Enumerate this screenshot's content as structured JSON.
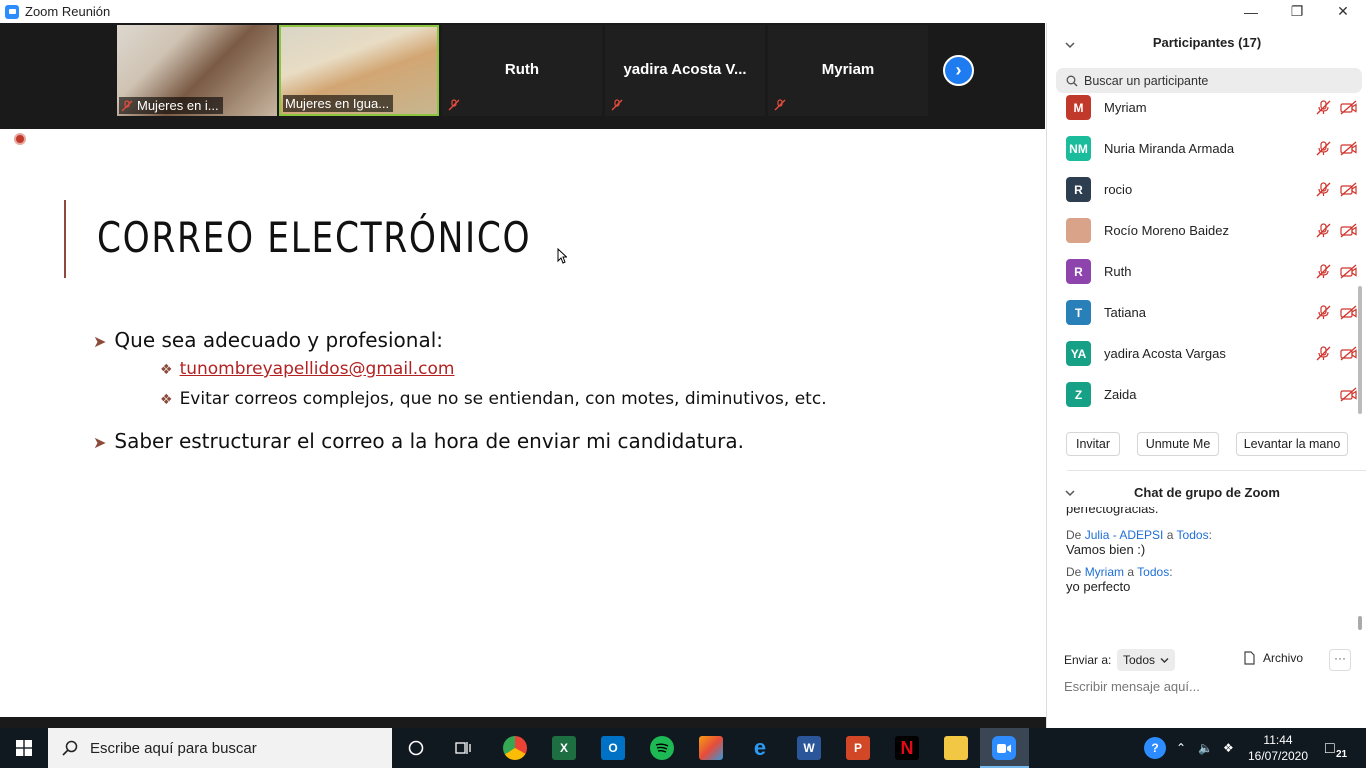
{
  "window": {
    "title": "Zoom Reunión"
  },
  "video_strip": {
    "tiles": [
      {
        "label": "Mujeres en i..."
      },
      {
        "label": "Mujeres en Igua..."
      },
      {
        "name": "Ruth"
      },
      {
        "name": "yadira Acosta V..."
      },
      {
        "name": "Myriam"
      }
    ],
    "next_button": "›"
  },
  "slide": {
    "title": "CORREO ELECTRÓNICO",
    "bullet1": "Que sea adecuado y profesional:",
    "sub1": "tunombreyapellidos@gmail.com",
    "sub2": "Evitar correos complejos, que no se entiendan, con motes, diminutivos, etc.",
    "bullet2": "Saber estructurar el correo a la hora de enviar mi candidatura."
  },
  "participants": {
    "header": "Participantes (17)",
    "search_placeholder": "Buscar un participante",
    "list": [
      {
        "initials": "M",
        "name": "Myriam",
        "color": "#c0392b"
      },
      {
        "initials": "NM",
        "name": "Nuria Miranda Armada",
        "color": "#1abc9c"
      },
      {
        "initials": "R",
        "name": "rocio",
        "color": "#2c3e50"
      },
      {
        "initials": "",
        "name": "Rocío Moreno Baidez",
        "color": "#d9a38a"
      },
      {
        "initials": "R",
        "name": "Ruth",
        "color": "#8e44ad"
      },
      {
        "initials": "T",
        "name": "Tatiana",
        "color": "#2980b9"
      },
      {
        "initials": "YA",
        "name": "yadira Acosta Vargas",
        "color": "#16a085"
      },
      {
        "initials": "Z",
        "name": "Zaida",
        "color": "#16a085"
      }
    ],
    "buttons": {
      "invite": "Invitar",
      "unmute": "Unmute Me",
      "raise_hand": "Levantar la mano"
    }
  },
  "chat": {
    "header": "Chat de grupo de Zoom",
    "partial_top": "perfectogracias.",
    "messages": [
      {
        "from": "Julia - ADEPSI",
        "to": "Todos",
        "text": "Vamos bien :)"
      },
      {
        "from": "Myriam",
        "to": "Todos",
        "text": "yo perfecto"
      }
    ],
    "from_word": "De",
    "to_word": "a",
    "send_to_label": "Enviar a:",
    "send_to_value": "Todos",
    "file_label": "Archivo",
    "more": "···",
    "input_placeholder": "Escribir mensaje aquí..."
  },
  "taskbar": {
    "search_placeholder": "Escribe aquí para buscar",
    "time": "11:44",
    "date": "16/07/2020",
    "notifications": "21"
  }
}
